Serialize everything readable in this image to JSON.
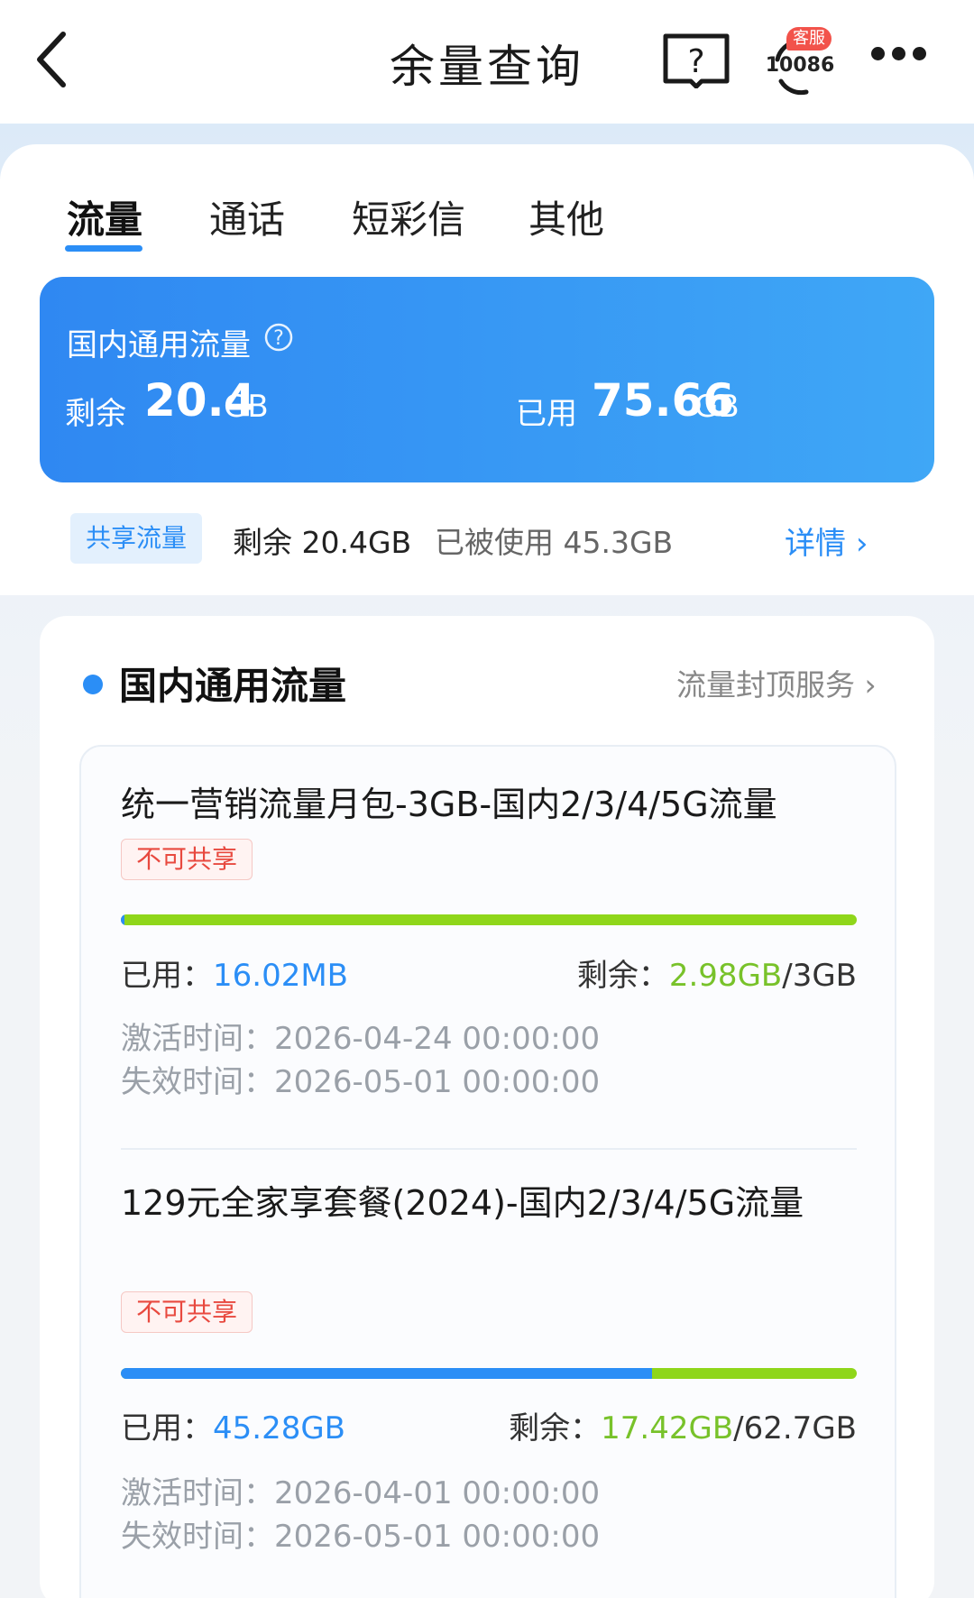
{
  "header": {
    "title": "余量查询",
    "service_badge": "客服",
    "service_number": "10086",
    "icons": [
      "back-arrow-icon",
      "help-book-icon",
      "customer-service-icon",
      "more-dots-icon"
    ]
  },
  "tabs": [
    {
      "label": "流量",
      "active": true
    },
    {
      "label": "通话",
      "active": false
    },
    {
      "label": "短彩信",
      "active": false
    },
    {
      "label": "其他",
      "active": false
    }
  ],
  "summary": {
    "title": "国内通用流量",
    "remain_label": "剩余",
    "remain_value": "20.4",
    "remain_unit": "GB",
    "used_label": "已用",
    "used_value": "75.66",
    "used_unit": "GB"
  },
  "share": {
    "tag": "共享流量",
    "remain": "剩余 20.4GB",
    "used": "已被使用 45.3GB",
    "detail": "详情"
  },
  "section": {
    "title": "国内通用流量",
    "link": "流量封顶服务"
  },
  "packages": [
    {
      "name": "统一营销流量月包-3GB-国内2/3/4/5G流量",
      "tag": "不可共享",
      "used_label": "已用：",
      "used_value": "16.02MB",
      "remain_label": "剩余：",
      "remain_value": "2.98GB",
      "total": "/3GB",
      "used_fraction": 0.005,
      "activate_label": "激活时间：",
      "activate_time": "2026-04-24 00:00:00",
      "expire_label": "失效时间：",
      "expire_time": "2026-05-01 00:00:00"
    },
    {
      "name": "129元全家享套餐(2024)-国内2/3/4/5G流量",
      "tag": "不可共享",
      "used_label": "已用：",
      "used_value": "45.28GB",
      "remain_label": "剩余：",
      "remain_value": "17.42GB",
      "total": "/62.7GB",
      "used_fraction": 0.722,
      "activate_label": "激活时间：",
      "activate_time": "2026-04-01 00:00:00",
      "expire_label": "失效时间：",
      "expire_time": "2026-05-01 00:00:00"
    }
  ],
  "colors": {
    "accent": "#2b8ef6",
    "remain_green": "#78c22a",
    "tag_red": "#e8493f"
  }
}
